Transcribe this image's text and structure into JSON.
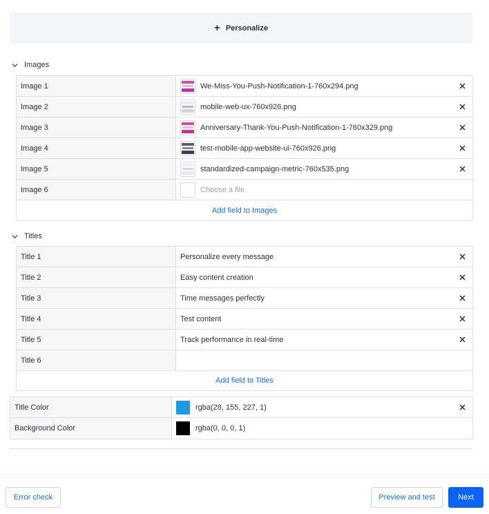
{
  "personalize": {
    "label": "Personalize"
  },
  "images": {
    "title": "Images",
    "rows": [
      {
        "label": "Image 1",
        "value": "We-Miss-You-Push-Notification-1-760x294.png",
        "thumb": "pink"
      },
      {
        "label": "Image 2",
        "value": "mobile-web-ux-760x926.png",
        "thumb": "light"
      },
      {
        "label": "Image 3",
        "value": "Anniversary-Thank-You-Push-Notification-1-760x329.png",
        "thumb": "pink"
      },
      {
        "label": "Image 4",
        "value": "test-mobile-app-website-ui-760x926.png",
        "thumb": "dark"
      },
      {
        "label": "Image 5",
        "value": "standardized-campaign-metric-760x535.png",
        "thumb": "pale"
      },
      {
        "label": "Image 6",
        "placeholder": "Choose a file"
      }
    ],
    "add_label": "Add field to Images"
  },
  "titles": {
    "title": "Titles",
    "rows": [
      {
        "label": "Title 1",
        "value": "Personalize every message"
      },
      {
        "label": "Title 2",
        "value": "Easy content creation"
      },
      {
        "label": "Title 3",
        "value": "Time messages perfectly"
      },
      {
        "label": "Title 4",
        "value": "Test content"
      },
      {
        "label": "Title 5",
        "value": "Track performance in real-time"
      },
      {
        "label": "Title 6",
        "value": ""
      }
    ],
    "add_label": "Add field to Titles"
  },
  "colors": {
    "title_color": {
      "label": "Title Color",
      "value": "rgba(28, 155, 227, 1)",
      "swatch": "#1c9be3"
    },
    "background_color": {
      "label": "Background Color",
      "value": "rgba(0, 0, 0, 1)",
      "swatch": "#000000"
    }
  },
  "footer": {
    "error_check": "Error check",
    "preview": "Preview and test",
    "next": "Next"
  },
  "icons": {
    "plus": "plus-icon",
    "chevron": "chevron-down-icon",
    "remove": "close-icon"
  },
  "theme": {
    "link": "#1a6cd6",
    "primary": "#0b63f4",
    "panel": "#f4f5f7"
  }
}
